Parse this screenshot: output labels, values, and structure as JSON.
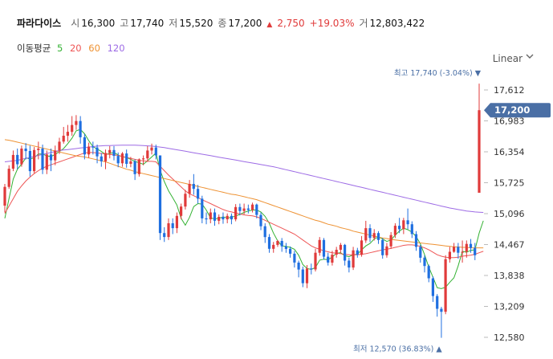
{
  "quote": {
    "name": "파라다이스",
    "open_label": "시",
    "open": "16,300",
    "high_label": "고",
    "high": "17,740",
    "low_label": "저",
    "low": "15,520",
    "close_label": "종",
    "close": "17,200",
    "change_arrow": "▲",
    "change": "2,750",
    "change_pct": "+19.03%",
    "volume_label": "거",
    "volume": "12,803,422"
  },
  "moving_average": {
    "title": "이동평균",
    "periods": [
      "5",
      "20",
      "60",
      "120"
    ],
    "colors": [
      "#34b233",
      "#ee5656",
      "#ee9233",
      "#9d6be5"
    ]
  },
  "scale_select": {
    "value": "Linear",
    "icon": "chevron-down-icon"
  },
  "colors": {
    "up": "#e03a3a",
    "down": "#1f6fe0",
    "tag_bg": "#4a6fa5"
  },
  "annotations": {
    "high_text": "최고 17,740 (-3.04%) ▼",
    "low_text": "최저 12,570 (36.83%) ▲",
    "current_tag": "17,200"
  },
  "chart_data": {
    "type": "candlestick",
    "y_ticks": [
      "17,612",
      "16,983",
      "16,354",
      "15,725",
      "15,096",
      "14,467",
      "13,838",
      "13,209",
      "12,580"
    ],
    "ylim": [
      12480,
      18100
    ],
    "grid": false,
    "high": 17740,
    "low": 12570,
    "last": 17200,
    "candles": [
      [
        15260,
        15640,
        15120,
        15700
      ],
      [
        15640,
        16010,
        15600,
        16080
      ],
      [
        16010,
        16290,
        15960,
        16380
      ],
      [
        16290,
        16100,
        16000,
        16420
      ],
      [
        16100,
        16420,
        16050,
        16480
      ],
      [
        16420,
        16370,
        16200,
        16530
      ],
      [
        16370,
        15960,
        15850,
        16480
      ],
      [
        15960,
        16390,
        15920,
        16450
      ],
      [
        16390,
        16420,
        16200,
        16560
      ],
      [
        16420,
        15990,
        15900,
        16500
      ],
      [
        15990,
        16300,
        15900,
        16380
      ],
      [
        16300,
        16180,
        15960,
        16420
      ],
      [
        16180,
        16380,
        16080,
        16480
      ],
      [
        16380,
        16560,
        16310,
        16640
      ],
      [
        16560,
        16680,
        16520,
        16860
      ],
      [
        16680,
        16760,
        16560,
        16900
      ],
      [
        16760,
        16900,
        16680,
        17080
      ],
      [
        16900,
        16980,
        16800,
        17100
      ],
      [
        16980,
        16650,
        16520,
        17080
      ],
      [
        16650,
        16300,
        16200,
        16720
      ],
      [
        16300,
        16460,
        16230,
        16540
      ],
      [
        16460,
        16440,
        16300,
        16560
      ],
      [
        16440,
        16260,
        16120,
        16500
      ],
      [
        16260,
        16160,
        16050,
        16330
      ],
      [
        16160,
        16330,
        16000,
        16400
      ],
      [
        16330,
        16390,
        16220,
        16470
      ],
      [
        16390,
        16270,
        16180,
        16470
      ],
      [
        16270,
        16120,
        16040,
        16340
      ],
      [
        16120,
        16320,
        16050,
        16350
      ],
      [
        16320,
        16110,
        16030,
        16400
      ],
      [
        16110,
        16160,
        16040,
        16250
      ],
      [
        16160,
        15900,
        15780,
        16200
      ],
      [
        15900,
        16200,
        15850,
        16220
      ],
      [
        16200,
        16220,
        16080,
        16280
      ],
      [
        16220,
        16380,
        16150,
        16470
      ],
      [
        16380,
        16440,
        16300,
        16520
      ],
      [
        16440,
        16280,
        16200,
        16500
      ],
      [
        16280,
        14700,
        14560,
        16280
      ],
      [
        14700,
        14620,
        14520,
        14820
      ],
      [
        14620,
        14900,
        14560,
        15000
      ],
      [
        14900,
        14800,
        14680,
        15000
      ],
      [
        14800,
        15050,
        14700,
        15120
      ],
      [
        15050,
        15240,
        14980,
        15300
      ],
      [
        15240,
        15500,
        15180,
        15580
      ],
      [
        15500,
        15700,
        15420,
        15780
      ],
      [
        15700,
        15600,
        15480,
        15900
      ],
      [
        15600,
        15400,
        15300,
        15680
      ],
      [
        15400,
        15000,
        14900,
        15460
      ],
      [
        15000,
        14980,
        14880,
        15120
      ],
      [
        14980,
        15120,
        14900,
        15200
      ],
      [
        15120,
        14950,
        14850,
        15200
      ],
      [
        14950,
        15030,
        14880,
        15080
      ],
      [
        15030,
        14980,
        14890,
        15120
      ],
      [
        14980,
        15050,
        14900,
        15100
      ],
      [
        15050,
        14980,
        14880,
        15100
      ],
      [
        14980,
        15230,
        14940,
        15290
      ],
      [
        15230,
        15150,
        15060,
        15300
      ],
      [
        15150,
        15200,
        15080,
        15300
      ],
      [
        15200,
        15170,
        15100,
        15280
      ],
      [
        15170,
        15280,
        15120,
        15320
      ],
      [
        15280,
        15070,
        15000,
        15300
      ],
      [
        15070,
        14840,
        14760,
        15120
      ],
      [
        14840,
        14620,
        14500,
        14900
      ],
      [
        14620,
        14380,
        14300,
        14680
      ],
      [
        14380,
        14460,
        14300,
        14520
      ],
      [
        14460,
        14540,
        14420,
        14560
      ],
      [
        14540,
        14430,
        14320,
        14600
      ],
      [
        14430,
        14380,
        14300,
        14500
      ],
      [
        14380,
        14280,
        14200,
        14430
      ],
      [
        14280,
        14100,
        14000,
        14340
      ],
      [
        14100,
        13960,
        13800,
        14140
      ],
      [
        13960,
        13680,
        13600,
        14020
      ],
      [
        13680,
        13980,
        13580,
        14050
      ],
      [
        13980,
        13960,
        13860,
        14080
      ],
      [
        13960,
        14300,
        13920,
        14380
      ],
      [
        14300,
        14560,
        14240,
        14620
      ],
      [
        14560,
        14220,
        14160,
        14600
      ],
      [
        14220,
        14100,
        14040,
        14300
      ],
      [
        14100,
        14260,
        14040,
        14340
      ],
      [
        14260,
        14360,
        14200,
        14420
      ],
      [
        14360,
        14460,
        14300,
        14500
      ],
      [
        14460,
        14140,
        14040,
        14480
      ],
      [
        14140,
        14000,
        13900,
        14200
      ],
      [
        14000,
        14350,
        13950,
        14420
      ],
      [
        14350,
        14260,
        14200,
        14400
      ],
      [
        14260,
        14550,
        14220,
        14640
      ],
      [
        14550,
        14800,
        14500,
        14950
      ],
      [
        14800,
        14600,
        14520,
        14880
      ],
      [
        14600,
        14700,
        14550,
        14780
      ],
      [
        14700,
        14560,
        14480,
        14740
      ],
      [
        14560,
        14250,
        14180,
        14600
      ],
      [
        14250,
        14430,
        14200,
        14500
      ],
      [
        14430,
        14660,
        14380,
        14720
      ],
      [
        14660,
        14850,
        14600,
        14900
      ],
      [
        14850,
        14780,
        14700,
        15010
      ],
      [
        14780,
        14960,
        14680,
        15010
      ],
      [
        14960,
        14880,
        14780,
        15200
      ],
      [
        14880,
        14680,
        14600,
        14940
      ],
      [
        14680,
        14420,
        14340,
        14740
      ],
      [
        14420,
        14200,
        14100,
        14460
      ],
      [
        14200,
        14030,
        13900,
        14250
      ],
      [
        14030,
        13780,
        13700,
        14060
      ],
      [
        13780,
        13420,
        13300,
        13820
      ],
      [
        13420,
        13160,
        13000,
        13460
      ],
      [
        13160,
        13100,
        12570,
        13200
      ],
      [
        13100,
        14170,
        13050,
        14250
      ],
      [
        14170,
        14320,
        14100,
        14420
      ],
      [
        14320,
        14420,
        14300,
        14500
      ],
      [
        14420,
        14300,
        14180,
        14500
      ],
      [
        14300,
        14320,
        14100,
        14550
      ],
      [
        14320,
        14480,
        14200,
        14550
      ],
      [
        14480,
        14400,
        14300,
        14580
      ],
      [
        14400,
        14250,
        14150,
        14500
      ],
      [
        15520,
        17200,
        15520,
        17740
      ]
    ],
    "ma5": [
      15000,
      15400,
      15800,
      16000,
      16100,
      16230,
      16210,
      16230,
      16310,
      16310,
      16270,
      16260,
      16300,
      16360,
      16420,
      16520,
      16630,
      16780,
      16810,
      16720,
      16580,
      16460,
      16410,
      16360,
      16300,
      16320,
      16340,
      16290,
      16250,
      16240,
      16200,
      16160,
      16130,
      16100,
      16170,
      16250,
      16330,
      15980,
      15750,
      15560,
      15420,
      15270,
      15000,
      14860,
      15020,
      15240,
      15300,
      15290,
      15170,
      15010,
      14990,
      15000,
      15030,
      15010,
      15020,
      15050,
      15080,
      15120,
      15150,
      15170,
      15170,
      15130,
      15040,
      14900,
      14700,
      14540,
      14440,
      14430,
      14410,
      14370,
      14250,
      14060,
      13980,
      13960,
      14000,
      14150,
      14170,
      14160,
      14210,
      14290,
      14300,
      14240,
      14220,
      14260,
      14270,
      14360,
      14440,
      14490,
      14580,
      14620,
      14580,
      14530,
      14560,
      14660,
      14740,
      14800,
      14770,
      14720,
      14630,
      14480,
      14260,
      14010,
      13800,
      13590,
      13570,
      13600,
      13700,
      13790,
      14030,
      14330,
      14310,
      14350,
      14360,
      14700,
      14950
    ],
    "ma20": [
      15100,
      15250,
      15400,
      15550,
      15660,
      15760,
      15840,
      15910,
      15970,
      16020,
      16060,
      16090,
      16120,
      16150,
      16180,
      16210,
      16240,
      16270,
      16300,
      16330,
      16340,
      16340,
      16330,
      16320,
      16310,
      16300,
      16290,
      16280,
      16260,
      16240,
      16220,
      16200,
      16180,
      16170,
      16160,
      16160,
      16150,
      16060,
      15970,
      15880,
      15800,
      15720,
      15640,
      15560,
      15500,
      15460,
      15420,
      15380,
      15340,
      15300,
      15260,
      15220,
      15180,
      15150,
      15130,
      15110,
      15090,
      15070,
      15060,
      15050,
      15030,
      15000,
      14960,
      14920,
      14880,
      14840,
      14800,
      14760,
      14720,
      14680,
      14620,
      14560,
      14500,
      14440,
      14400,
      14370,
      14340,
      14320,
      14300,
      14290,
      14280,
      14270,
      14260,
      14260,
      14260,
      14270,
      14280,
      14300,
      14320,
      14340,
      14360,
      14370,
      14390,
      14410,
      14430,
      14450,
      14460,
      14460,
      14450,
      14430,
      14400,
      14360,
      14310,
      14260,
      14230,
      14210,
      14200,
      14200,
      14210,
      14230,
      14240,
      14250,
      14270,
      14300,
      14330
    ],
    "ma60": [
      16600,
      16590,
      16570,
      16550,
      16530,
      16510,
      16490,
      16470,
      16450,
      16430,
      16410,
      16390,
      16370,
      16350,
      16330,
      16310,
      16290,
      16270,
      16260,
      16250,
      16230,
      16210,
      16190,
      16170,
      16150,
      16120,
      16090,
      16060,
      16030,
      16000,
      15980,
      15950,
      15930,
      15910,
      15890,
      15870,
      15850,
      15830,
      15810,
      15790,
      15770,
      15750,
      15730,
      15710,
      15690,
      15670,
      15650,
      15630,
      15610,
      15590,
      15570,
      15550,
      15530,
      15510,
      15490,
      15480,
      15460,
      15440,
      15420,
      15400,
      15380,
      15350,
      15320,
      15290,
      15260,
      15230,
      15200,
      15170,
      15140,
      15110,
      15080,
      15050,
      15020,
      14990,
      14960,
      14940,
      14910,
      14880,
      14860,
      14840,
      14810,
      14790,
      14770,
      14740,
      14720,
      14700,
      14680,
      14660,
      14640,
      14620,
      14600,
      14590,
      14570,
      14560,
      14550,
      14540,
      14530,
      14520,
      14510,
      14500,
      14490,
      14480,
      14470,
      14460,
      14450,
      14440,
      14430,
      14420,
      14420,
      14410,
      14410,
      14400,
      14400,
      14400,
      14400
    ],
    "ma120": [
      16150,
      16160,
      16170,
      16180,
      16200,
      16220,
      16240,
      16260,
      16280,
      16300,
      16320,
      16340,
      16360,
      16380,
      16390,
      16400,
      16410,
      16420,
      16430,
      16440,
      16450,
      16460,
      16470,
      16475,
      16480,
      16482,
      16484,
      16486,
      16488,
      16490,
      16490,
      16488,
      16485,
      16480,
      16475,
      16470,
      16460,
      16450,
      16440,
      16425,
      16410,
      16395,
      16380,
      16365,
      16350,
      16335,
      16320,
      16305,
      16290,
      16275,
      16260,
      16245,
      16230,
      16215,
      16200,
      16185,
      16170,
      16155,
      16140,
      16125,
      16110,
      16095,
      16080,
      16065,
      16050,
      16030,
      16010,
      15990,
      15970,
      15950,
      15930,
      15910,
      15890,
      15870,
      15850,
      15830,
      15810,
      15790,
      15770,
      15750,
      15730,
      15710,
      15690,
      15670,
      15650,
      15630,
      15610,
      15590,
      15570,
      15550,
      15530,
      15510,
      15490,
      15470,
      15450,
      15430,
      15410,
      15390,
      15370,
      15350,
      15330,
      15310,
      15290,
      15270,
      15250,
      15230,
      15210,
      15195,
      15180,
      15165,
      15150,
      15140,
      15130,
      15125,
      15120
    ]
  }
}
